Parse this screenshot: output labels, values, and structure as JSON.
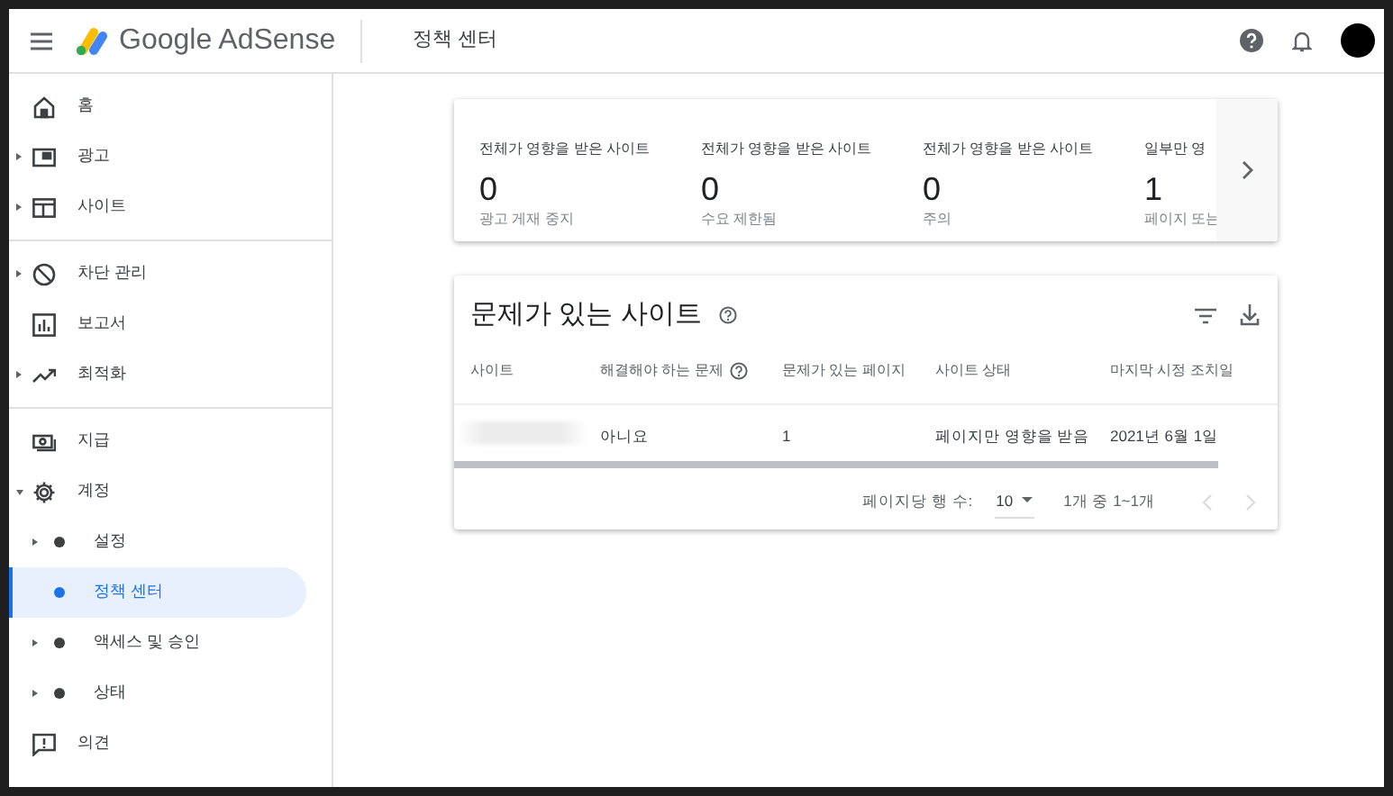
{
  "header": {
    "logo_text": "Google AdSense",
    "page_title": "정책 센터"
  },
  "sidebar": {
    "groups": [
      [
        {
          "label": "홈",
          "selected": false
        },
        {
          "label": "광고",
          "expanded": false,
          "selected": false
        },
        {
          "label": "사이트",
          "expanded": false,
          "selected": false
        }
      ],
      [
        {
          "label": "차단 관리",
          "expanded": false,
          "selected": false
        },
        {
          "label": "보고서",
          "selected": false
        },
        {
          "label": "최적화",
          "expanded": false,
          "selected": false
        }
      ],
      [
        {
          "label": "지급",
          "selected": false
        },
        {
          "label": "계정",
          "expanded": true,
          "selected": false,
          "children": [
            {
              "label": "설정",
              "expanded": false,
              "selected": false
            },
            {
              "label": "정책 센터",
              "selected": true
            },
            {
              "label": "액세스 및 승인",
              "expanded": false,
              "selected": false
            },
            {
              "label": "상태",
              "expanded": false,
              "selected": false
            }
          ]
        },
        {
          "label": "의견",
          "selected": false
        }
      ]
    ]
  },
  "summary": [
    {
      "title": "전체가 영향을 받은 사이트",
      "count": "0",
      "subtitle": "광고 게재 중지"
    },
    {
      "title": "전체가 영향을 받은 사이트",
      "count": "0",
      "subtitle": "수요 제한됨"
    },
    {
      "title": "전체가 영향을 받은 사이트",
      "count": "0",
      "subtitle": "주의"
    },
    {
      "title": "일부만 영",
      "count": "1",
      "subtitle": "페이지 또는"
    }
  ],
  "table": {
    "title": "문제가 있는 사이트",
    "columns": [
      {
        "label": "사이트",
        "help": false
      },
      {
        "label": "해결해야 하는 문제",
        "help": true
      },
      {
        "label": "문제가 있는 페이지",
        "help": false
      },
      {
        "label": "사이트 상태",
        "help": false
      },
      {
        "label": "마지막 시정 조치일",
        "help": false
      }
    ],
    "rows": [
      {
        "cells": [
          "",
          "아니요",
          "1",
          "페이지만 영향을 받음",
          "2021년 6월 1일"
        ]
      }
    ],
    "rows_per_page_label": "페이지당 행 수:",
    "rows_per_page": "10",
    "range": "1개 중 1~1개"
  }
}
